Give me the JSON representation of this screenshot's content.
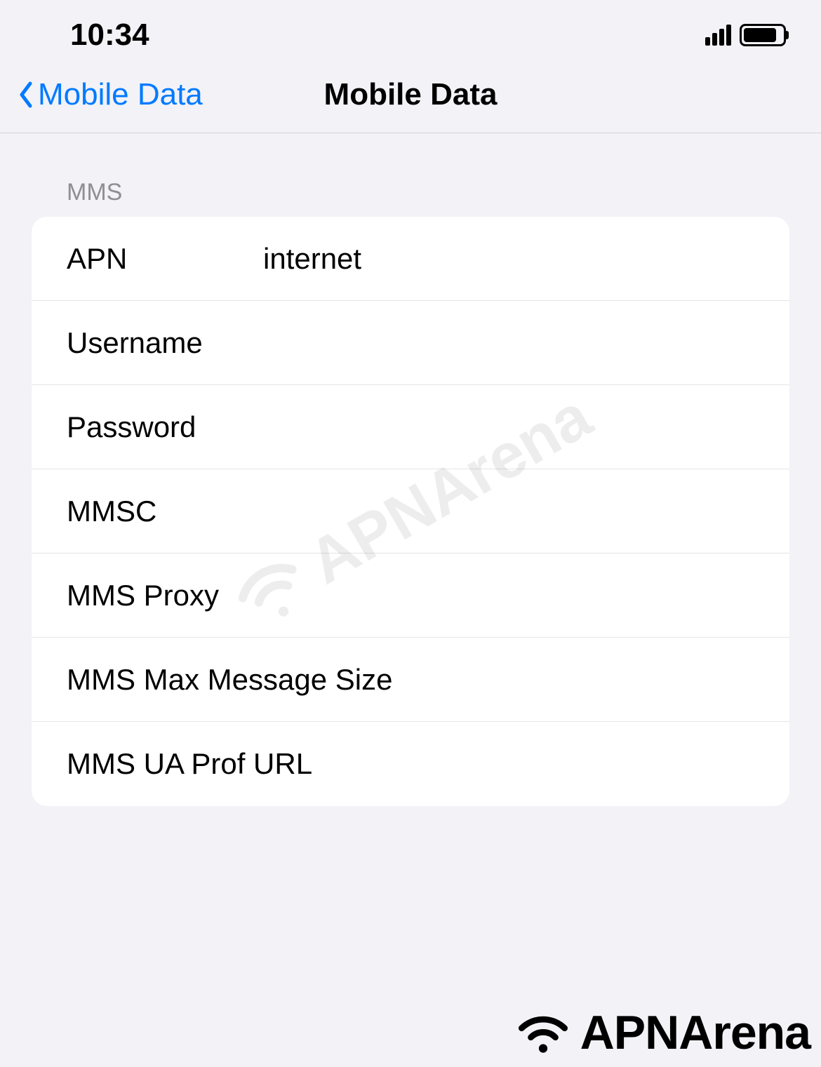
{
  "statusBar": {
    "time": "10:34"
  },
  "navBar": {
    "backLabel": "Mobile Data",
    "title": "Mobile Data"
  },
  "section": {
    "header": "MMS",
    "rows": [
      {
        "label": "APN",
        "value": "internet"
      },
      {
        "label": "Username",
        "value": ""
      },
      {
        "label": "Password",
        "value": ""
      },
      {
        "label": "MMSC",
        "value": ""
      },
      {
        "label": "MMS Proxy",
        "value": ""
      },
      {
        "label": "MMS Max Message Size",
        "value": ""
      },
      {
        "label": "MMS UA Prof URL",
        "value": ""
      }
    ]
  },
  "watermark": {
    "text": "APNArena"
  },
  "footer": {
    "brand": "APNArena"
  }
}
